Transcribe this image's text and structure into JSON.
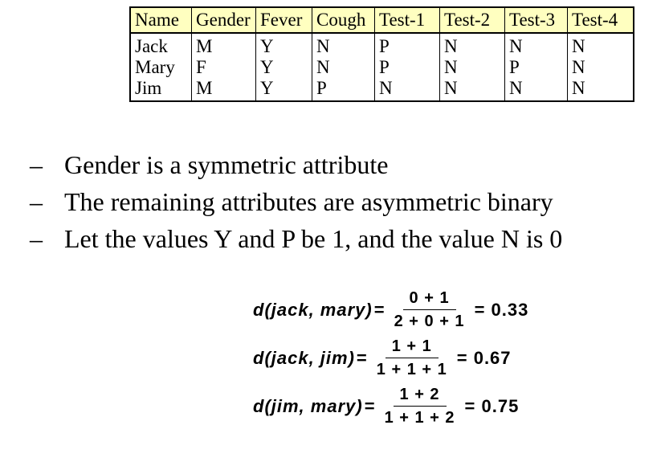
{
  "table": {
    "columns": [
      "Name",
      "Gender",
      "Fever",
      "Cough",
      "Test-1",
      "Test-2",
      "Test-3",
      "Test-4"
    ],
    "rows": [
      [
        "Jack",
        "M",
        "Y",
        "N",
        "P",
        "N",
        "N",
        "N"
      ],
      [
        "Mary",
        "F",
        "Y",
        "N",
        "P",
        "N",
        "P",
        "N"
      ],
      [
        "Jim",
        "M",
        "Y",
        "P",
        "N",
        "N",
        "N",
        "N"
      ]
    ],
    "header_bg": "#ffffc0"
  },
  "bullets": {
    "dash": "–",
    "items": [
      "Gender is a symmetric attribute",
      "The remaining attributes are asymmetric binary",
      "Let the values Y and P be 1, and the value N is 0"
    ]
  },
  "formulas": [
    {
      "lhs": "d(jack, mary)",
      "eq": "=",
      "numerator": "0 + 1",
      "denominator": "2 + 0 + 1",
      "result": "= 0.33"
    },
    {
      "lhs": "d(jack, jim)",
      "eq": "=",
      "numerator": "1 + 1",
      "denominator": "1 + 1 + 1",
      "result": "= 0.67"
    },
    {
      "lhs": "d(jim, mary)",
      "eq": "=",
      "numerator": "1 + 2",
      "denominator": "1 + 1 + 2",
      "result": "= 0.75"
    }
  ]
}
